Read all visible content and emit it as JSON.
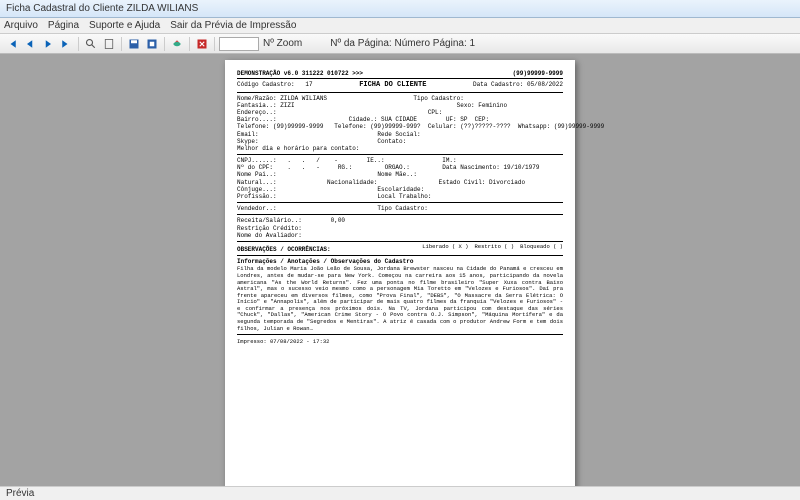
{
  "window": {
    "title": "Ficha Cadastral do Cliente ZILDA WILIANS"
  },
  "menu": {
    "arquivo": "Arquivo",
    "pagina": "Página",
    "suporte": "Suporte e Ajuda",
    "sair": "Sair da Prévia de Impressão"
  },
  "toolbar": {
    "zoom_label": "Nº Zoom",
    "zoom_value": "",
    "page_label": "Nº da Página: Número Página: 1"
  },
  "status": {
    "text": "Prévia"
  },
  "doc": {
    "header_left": "DEMONSTRAÇÃO v6.0 311222 010722 >>>",
    "header_right": "(99)99999-9999",
    "codigo_label": "Código Cadastro:",
    "codigo_val": "17",
    "ficha": "FICHA DO CLIENTE",
    "data_label": "Data Cadastro: 05/08/2022",
    "l1": "Nome/Razão: ZILDA WILIANS                        Tipo Cadastro:",
    "l2": "Fantasia..: ZIZI                                             Sexo: Feminino",
    "l3": "Endereço..:                                          CPL:",
    "l4": "Bairro....:                    Cidade.: SUA CIDADE        UF: SP  CEP:",
    "l5": "Telefone: (99)99999-9999   Telefone: (99)99999-999?  Celular: (??)?????-????  Whatsapp: (99)99999-9999",
    "l6": "Email:                                 Rede Social:",
    "l7": "Skype:                                 Contato:",
    "l8": "Melhor dia e horário para contato:",
    "l9": "CNPJ......:   .   .   /    -        IE..:                IM.:",
    "l10": "Nº do CPF:    .   .   -     RG.:         ORGAO.:         Data Nascimento: 19/10/1979",
    "l11": "Nome Pai..:                            Nome Mãe..:",
    "l12": "Natural...:              Nacionalidade:                 Estado Civil: Divorciado",
    "l13": "Cônjuge...:                            Escolaridade:",
    "l14": "Profissão.:                            Local Trabalho:",
    "l15": "Vendedor..:                            Tipo Cadastro:",
    "l16": "Receita/Salário..:        0,00",
    "l17": "Restrição Crédito:",
    "l18": "Nome do Avaliador:",
    "obs_title": "OBSERVAÇÕES / OCORRÊNCIAS:",
    "flag_lib": "Liberado ( X )",
    "flag_res": "Restrito (   )",
    "flag_blq": "Bloqueado (   )",
    "info_title": "Informações / Anotações / Observações do Cadastro",
    "obs_text": "Filha da modelo Maria João Leão de Sousa, Jordana Brewster nasceu na Cidade do Panamá e cresceu em Londres, antes de mudar-se para New York. Começou na carreira aos 15 anos, participando da novela americana \"As the World Returns\". Fez uma ponta no filme brasileiro \"Super Xuxa contra Baixo Astral\", mas o sucesso veio mesmo como a personagem Mia Toretto em \"Velozes e Furiosos\". Daí pra frente apareceu em diversos filmes, como \"Prova Final\", \"DEBS\", \"O Massacre da Serra Elétrica: O Início\" e \"Annapolis\", além de participar de mais quatro filmes da franquia \"Velozes e Furiosos\" - e confirmar a presença nos próximos dois. Na TV, Jordana participou com destaque das séries \"Chuck\", \"Dallas\", \"American Crime Story - O Povo contra O.J. Simpson\", \"Máquina Mortífera\" e da segunda temporada de \"Segredos e Mentiras\". A atriz é casada com o produtor Andrew Form e tem dois filhos, Julian e Rowan…",
    "impresso": "Impresso: 07/08/2022 - 17:32"
  }
}
